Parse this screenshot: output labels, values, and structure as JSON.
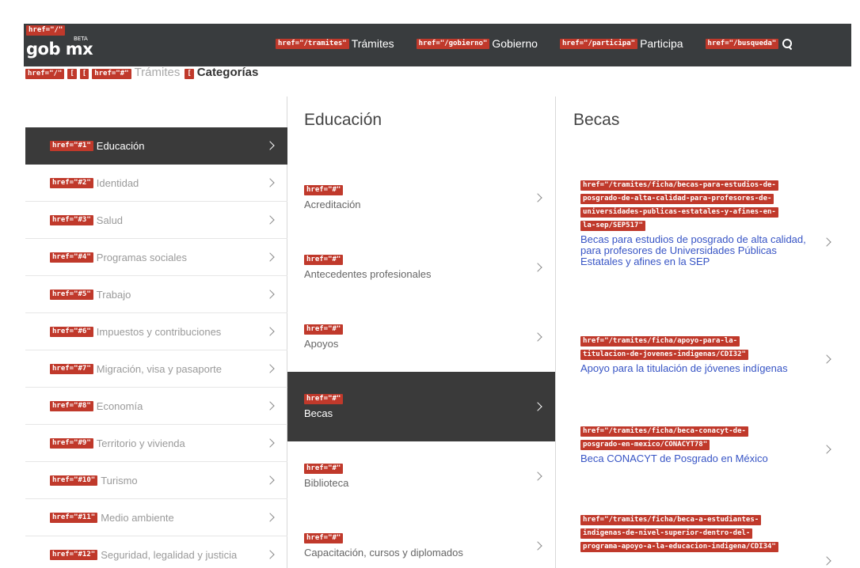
{
  "header": {
    "logo_tag": "href=\"/\"",
    "logo_text": "gob mx",
    "logo_badge": "BETA",
    "nav": [
      {
        "tag": "href=\"/tramites\"",
        "label": "Trámites"
      },
      {
        "tag": "href=\"/gobierno\"",
        "label": "Gobierno"
      },
      {
        "tag": "href=\"/participa\"",
        "label": "Participa"
      },
      {
        "tag": "href=\"/busqueda\"",
        "label": "",
        "icon": "search-icon"
      }
    ]
  },
  "breadcrumb": {
    "tag_home": "href=\"/\"",
    "tag_sep1": "[",
    "tag_sep2": "[",
    "tag_tramites": "href=\"#\"",
    "tramites": "Trámites",
    "tag_sep3": "[",
    "current": "Categorías"
  },
  "left": {
    "items": [
      {
        "tag": "href=\"#1\"",
        "label": "Educación",
        "active": true
      },
      {
        "tag": "href=\"#2\"",
        "label": "Identidad"
      },
      {
        "tag": "href=\"#3\"",
        "label": "Salud"
      },
      {
        "tag": "href=\"#4\"",
        "label": "Programas sociales"
      },
      {
        "tag": "href=\"#5\"",
        "label": "Trabajo"
      },
      {
        "tag": "href=\"#6\"",
        "label": "Impuestos y contribuciones"
      },
      {
        "tag": "href=\"#7\"",
        "label": "Migración, visa y pasaporte"
      },
      {
        "tag": "href=\"#8\"",
        "label": "Economía"
      },
      {
        "tag": "href=\"#9\"",
        "label": "Territorio y vivienda"
      },
      {
        "tag": "href=\"#10\"",
        "label": "Turismo"
      },
      {
        "tag": "href=\"#11\"",
        "label": "Medio ambiente"
      },
      {
        "tag": "href=\"#12\"",
        "label": "Seguridad, legalidad y justicia"
      }
    ]
  },
  "middle": {
    "title": "Educación",
    "items": [
      {
        "tag": "href=\"#\"",
        "label": "Acreditación"
      },
      {
        "tag": "href=\"#\"",
        "label": "Antecedentes profesionales"
      },
      {
        "tag": "href=\"#\"",
        "label": "Apoyos"
      },
      {
        "tag": "href=\"#\"",
        "label": "Becas",
        "active": true
      },
      {
        "tag": "href=\"#\"",
        "label": "Biblioteca"
      },
      {
        "tag": "href=\"#\"",
        "label": "Capacitación, cursos y diplomados"
      }
    ]
  },
  "right": {
    "title": "Becas",
    "items": [
      {
        "tags": [
          "href=\"/tramites/ficha/becas-para-estudios-de-",
          "posgrado-de-alta-calidad-para-profesores-de-",
          "universidades-publicas-estatales-y-afines-en-",
          "la-sep/SEP517\""
        ],
        "label": "Becas para estudios de posgrado de alta calidad, para profesores de Universidades Públicas Estatales y afines en la SEP"
      },
      {
        "tags": [
          "href=\"/tramites/ficha/apoyo-para-la-",
          "titulacion-de-jovenes-indigenas/CDI32\""
        ],
        "label": "Apoyo para la titulación de jóvenes indígenas"
      },
      {
        "tags": [
          "href=\"/tramites/ficha/beca-conacyt-de-",
          "posgrado-en-mexico/CONACYT78\""
        ],
        "label": "Beca CONACYT de Posgrado en México"
      },
      {
        "tags": [
          "href=\"/tramites/ficha/beca-a-estudiantes-",
          "indigenas-de-nivel-superior-dentro-del-",
          "programa-apoyo-a-la-educacion-indigena/CDI34\""
        ],
        "label": ""
      }
    ]
  }
}
